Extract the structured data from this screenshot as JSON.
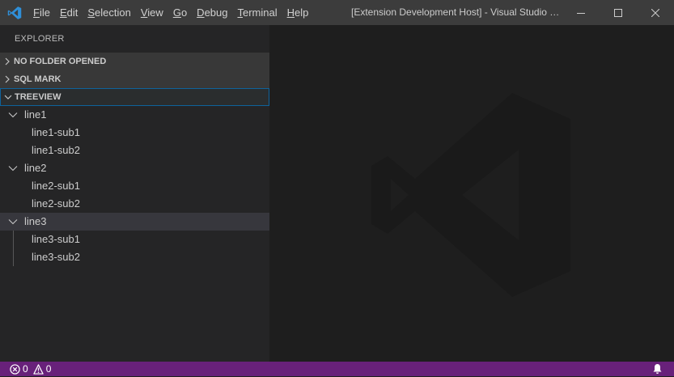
{
  "titlebar": {
    "menu": [
      {
        "mnemonic": "F",
        "rest": "ile"
      },
      {
        "mnemonic": "E",
        "rest": "dit"
      },
      {
        "mnemonic": "S",
        "rest": "election"
      },
      {
        "mnemonic": "V",
        "rest": "iew"
      },
      {
        "mnemonic": "G",
        "rest": "o"
      },
      {
        "mnemonic": "D",
        "rest": "ebug"
      },
      {
        "mnemonic": "T",
        "rest": "erminal"
      },
      {
        "mnemonic": "H",
        "rest": "elp"
      }
    ],
    "window_title": "[Extension Development Host] - Visual Studio C..."
  },
  "sidebar": {
    "title": "EXPLORER",
    "sections": [
      {
        "label": "NO FOLDER OPENED"
      },
      {
        "label": "SQL MARK"
      },
      {
        "label": "TREEVIEW"
      }
    ],
    "tree": [
      {
        "label": "line1",
        "children": [
          "line1-sub1",
          "line1-sub2"
        ]
      },
      {
        "label": "line2",
        "children": [
          "line2-sub1",
          "line2-sub2"
        ]
      },
      {
        "label": "line3",
        "children": [
          "line3-sub1",
          "line3-sub2"
        ]
      }
    ]
  },
  "statusbar": {
    "errors": "0",
    "warnings": "0"
  },
  "colors": {
    "titlebar_bg": "#3c3c3c",
    "sidebar_bg": "#252526",
    "editor_bg": "#1e1e1e",
    "statusbar_bg": "#68217a",
    "accent_icon": "#2f8fd8",
    "focus_border": "#0e639c"
  },
  "icons": {
    "app": "vscode-logo-icon",
    "section_collapsed": "chevron-right-icon",
    "section_expanded": "chevron-down-icon",
    "errors": "error-circle-icon",
    "warnings": "warning-triangle-icon",
    "notifications": "bell-icon"
  }
}
